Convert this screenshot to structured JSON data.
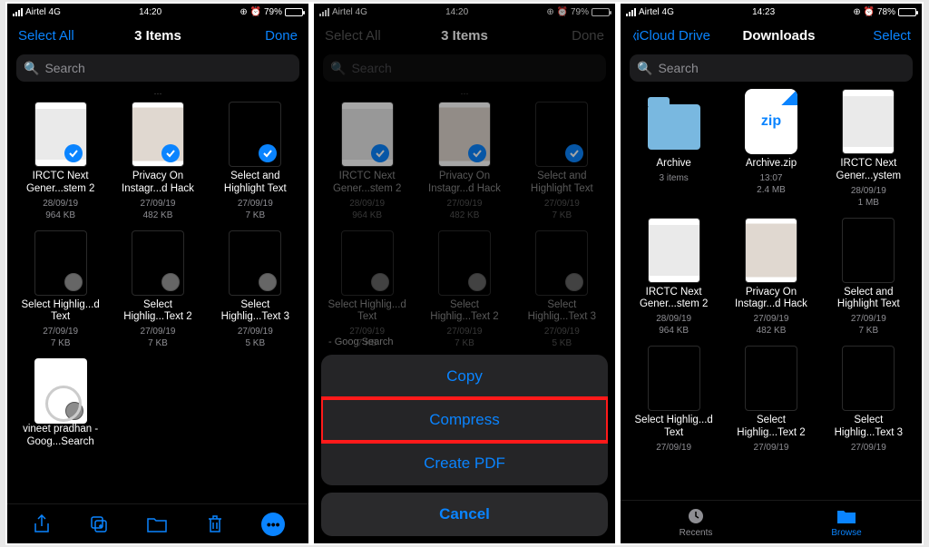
{
  "screen1": {
    "status": {
      "carrier": "Airtel 4G",
      "time": "14:20",
      "battery": "79%"
    },
    "nav": {
      "left": "Select All",
      "title": "3 Items",
      "right": "Done"
    },
    "search_placeholder": "Search",
    "files": [
      {
        "name": "IRCTC Next Gener...stem 2",
        "date": "28/09/19",
        "size": "964 KB",
        "sel": true,
        "thumb": "ss"
      },
      {
        "name": "Privacy On Instagr...d Hack",
        "date": "27/09/19",
        "size": "482 KB",
        "sel": true,
        "thumb": "ss2"
      },
      {
        "name": "Select and Highlight Text",
        "date": "27/09/19",
        "size": "7 KB",
        "sel": true,
        "thumb": "dark"
      },
      {
        "name": "Select Highlig...d Text",
        "date": "27/09/19",
        "size": "7 KB",
        "sel": false,
        "thumb": "dark"
      },
      {
        "name": "Select Highlig...Text 2",
        "date": "27/09/19",
        "size": "7 KB",
        "sel": false,
        "thumb": "dark"
      },
      {
        "name": "Select Highlig...Text 3",
        "date": "27/09/19",
        "size": "5 KB",
        "sel": false,
        "thumb": "dark"
      },
      {
        "name": "vineet pradhan - Goog...Search",
        "date": "",
        "size": "",
        "sel": false,
        "thumb": "gsearch"
      }
    ]
  },
  "screen2": {
    "status": {
      "carrier": "Airtel 4G",
      "time": "14:20",
      "battery": "79%"
    },
    "nav": {
      "left": "Select All",
      "title": "3 Items",
      "right": "Done"
    },
    "search_placeholder": "Search",
    "files_same_as_screen1": true,
    "sheet": {
      "copy": "Copy",
      "compress": "Compress",
      "createpdf": "Create PDF",
      "cancel": "Cancel"
    },
    "peek": "- Goog   Search"
  },
  "screen3": {
    "status": {
      "carrier": "Airtel 4G",
      "time": "14:23",
      "battery": "78%"
    },
    "nav": {
      "back": "iCloud Drive",
      "title": "Downloads",
      "right": "Select"
    },
    "search_placeholder": "Search",
    "files": [
      {
        "name": "Archive",
        "meta1": "3 items",
        "meta2": "",
        "thumb": "folder"
      },
      {
        "name": "Archive.zip",
        "meta1": "13:07",
        "meta2": "2.4 MB",
        "thumb": "zip"
      },
      {
        "name": "IRCTC Next Gener...ystem",
        "meta1": "28/09/19",
        "meta2": "1 MB",
        "thumb": "ss"
      },
      {
        "name": "IRCTC Next Gener...stem 2",
        "meta1": "28/09/19",
        "meta2": "964 KB",
        "thumb": "ss"
      },
      {
        "name": "Privacy On Instagr...d Hack",
        "meta1": "27/09/19",
        "meta2": "482 KB",
        "thumb": "ss2"
      },
      {
        "name": "Select and Highlight Text",
        "meta1": "27/09/19",
        "meta2": "7 KB",
        "thumb": "dark"
      },
      {
        "name": "Select Highlig...d Text",
        "meta1": "27/09/19",
        "meta2": "",
        "thumb": "dark"
      },
      {
        "name": "Select Highlig...Text 2",
        "meta1": "27/09/19",
        "meta2": "",
        "thumb": "dark"
      },
      {
        "name": "Select Highlig...Text 3",
        "meta1": "27/09/19",
        "meta2": "",
        "thumb": "dark"
      }
    ],
    "tabs": {
      "recents": "Recents",
      "browse": "Browse"
    }
  }
}
